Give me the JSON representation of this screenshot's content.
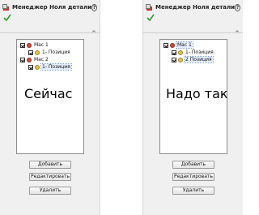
{
  "title": "Менеджер Ноля детали",
  "help_glyph": "?",
  "collapse_glyph": "^",
  "before": {
    "overlay_text": "Сейчас",
    "tree": [
      {
        "label": "Мас 1",
        "checked": true,
        "icon": "mac-icon"
      },
      {
        "label": "1- Позиция",
        "checked": true,
        "icon": "position-icon",
        "selected": false
      },
      {
        "label": "Мас 2",
        "checked": true,
        "icon": "mac-icon"
      },
      {
        "label": "1- Позиция",
        "checked": true,
        "icon": "position-icon",
        "selected": true
      }
    ]
  },
  "after": {
    "overlay_text": "Надо так",
    "tree": [
      {
        "label": "Мас 1",
        "checked": true,
        "icon": "mac-icon",
        "selected": true
      },
      {
        "label": "1- Позиция",
        "checked": true,
        "icon": "position-icon"
      },
      {
        "label": "2 Позиция",
        "checked": true,
        "icon": "position-icon",
        "selected": true
      }
    ]
  },
  "buttons": {
    "add": "Добавить",
    "edit": "Редактировать",
    "delete": "Удалить"
  },
  "colors": {
    "check_green": "#2e9b2e",
    "mac_icon": "#d24b3a",
    "position_icon": "#e2c44a"
  }
}
